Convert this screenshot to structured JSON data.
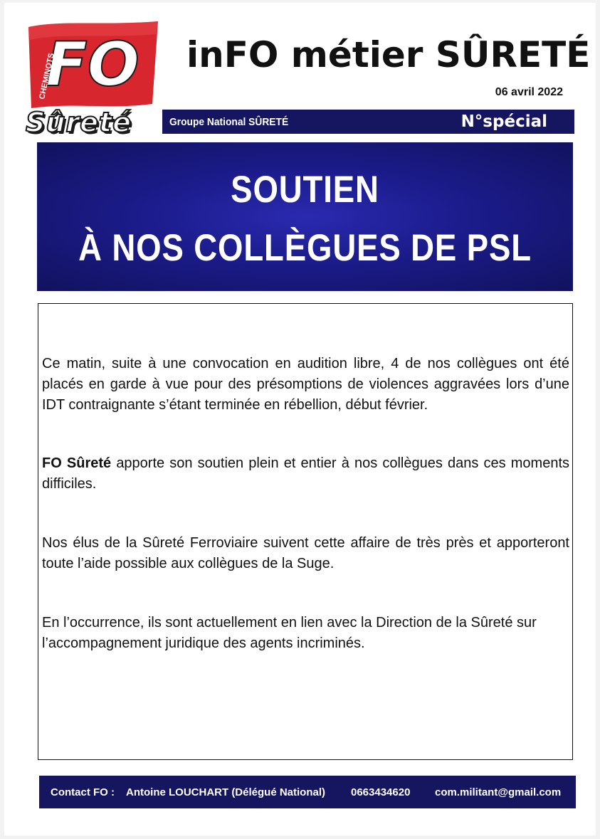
{
  "logo": {
    "flag_text": "FO",
    "flag_side_text": "CHEMINOTS",
    "wordmark": "Sûreté",
    "flag_color": "#d7262e"
  },
  "header": {
    "title": "inFO métier SÛRETÉ",
    "date": "06 avril 2022",
    "group_name": "Groupe National SÛRETÉ",
    "issue": "N°spécial"
  },
  "banner": {
    "line1": "SOUTIEN",
    "line2": "À NOS COLLÈGUES DE PSL"
  },
  "body": {
    "p1": "Ce matin, suite à une convocation en audition libre, 4 de nos collègues ont été placés en garde à vue pour des présomptions de violences aggravées lors d’une IDT contraignante s’étant terminée en rébellion, début février.",
    "p2_bold": "FO Sûreté",
    "p2_rest": " apporte son soutien plein et entier à nos collègues dans ces moments difficiles.",
    "p3": "Nos élus de la Sûreté Ferroviaire suivent cette affaire de très près et apporteront toute l’aide possible aux collègues de la Suge.",
    "p4": "En l’occurrence, ils sont actuellement en lien avec la Direction de la Sûreté sur l’accompagnement juridique des agents incriminés."
  },
  "footer": {
    "contact_label": "Contact FO :",
    "contact_name": "Antoine LOUCHART (Délégué National)",
    "phone": "0663434620",
    "email": "com.militant@gmail.com"
  },
  "colors": {
    "navy": "#161660",
    "banner_blue": "#1b1b8a",
    "brand_red": "#d7262e"
  }
}
